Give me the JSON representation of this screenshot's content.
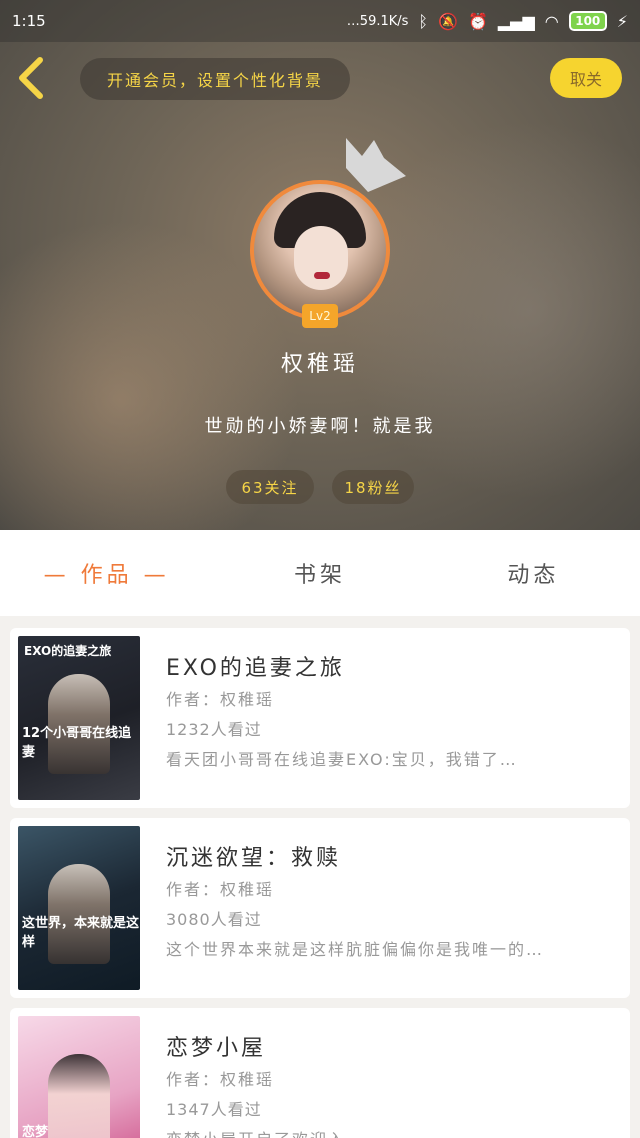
{
  "status_bar": {
    "time": "1:15",
    "net_speed": "…59.1K/s",
    "battery": "100",
    "icons": [
      "bluetooth-icon",
      "mute-icon",
      "alarm-icon",
      "signal-icon",
      "wifi-icon",
      "charging-icon"
    ]
  },
  "header": {
    "back_icon": "chevron-left-icon",
    "vip_banner": "开通会员，设置个性化背景",
    "follow_label": "取关"
  },
  "profile": {
    "level": "Lv2",
    "name": "权稚瑶",
    "bio": "世勋的小娇妻啊！就是我",
    "following": "63关注",
    "fans": "18粉丝"
  },
  "tabs": [
    {
      "label": "— 作品 —",
      "active": true
    },
    {
      "label": "书架",
      "active": false
    },
    {
      "label": "动态",
      "active": false
    }
  ],
  "books": [
    {
      "title": "EXO的追妻之旅",
      "author": "作者：权稚瑶",
      "views": "1232人看过",
      "desc": "看天团小哥哥在线追妻EXO:宝贝，我错了…",
      "cover_text": "EXO的追妻之旅",
      "cover_bottom": "12个小哥哥在线追妻"
    },
    {
      "title": "沉迷欲望：救赎",
      "author": "作者：权稚瑶",
      "views": "3080人看过",
      "desc": "这个世界本来就是这样肮脏偏偏你是我唯一的…",
      "cover_text": "",
      "cover_bottom": "这世界，本来就是这样"
    },
    {
      "title": "恋梦小屋",
      "author": "作者：权稚瑶",
      "views": "1347人看过",
      "desc": "恋梦小屋开启了欢迎入",
      "cover_text": "",
      "cover_bottom": "恋梦"
    }
  ],
  "colors": {
    "accent": "#ef7a3a",
    "yellow": "#f6d42f",
    "avatar_border": "#f08a3c"
  }
}
